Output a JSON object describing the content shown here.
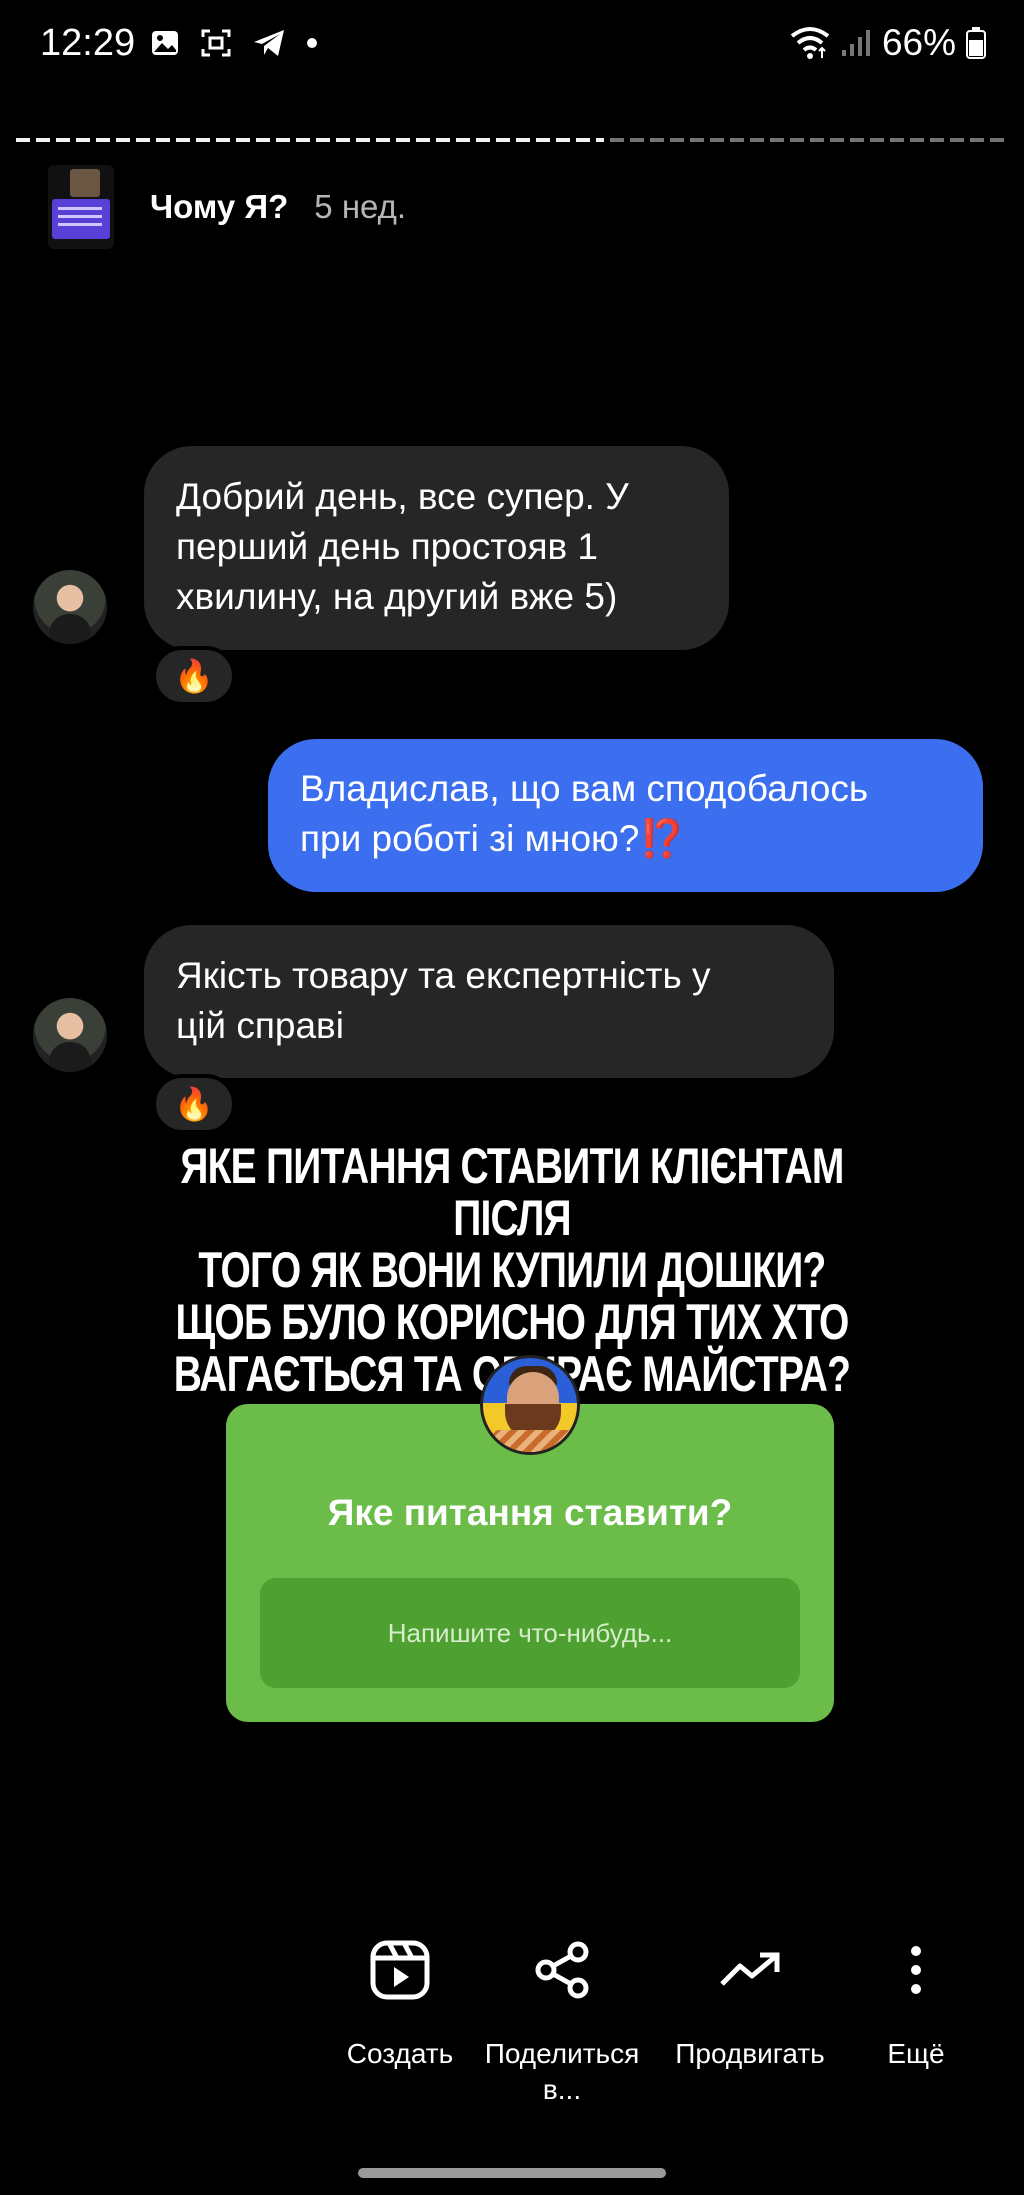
{
  "status_bar": {
    "time": "12:29",
    "battery": "66%",
    "icons": [
      "gallery-icon",
      "screenshot-icon",
      "telegram-icon",
      "dot-icon",
      "wifi-icon",
      "signal-icon",
      "battery-icon"
    ]
  },
  "story": {
    "segments": 2,
    "active_segment": 1,
    "author": "Чому Я?",
    "age": "5 нед."
  },
  "chat": {
    "msg1": "Добрий день, все супер. У\nперший день простояв 1\nхвилину, на другий вже 5)",
    "msg1_reaction": "🔥",
    "msg2": "Владислав, що вам сподобалось\nпри роботі зі мною?",
    "msg2_emoji": "⁉️",
    "msg3": "Якість товару та експертність у\nцій справі",
    "msg3_reaction": "🔥"
  },
  "headline": "ЯКЕ ПИТАННЯ СТАВИТИ КЛІЄНТАМ ПІСЛЯ\nТОГО ЯК ВОНИ КУПИЛИ ДОШКИ?\nЩОБ БУЛО КОРИСНО ДЛЯ ТИХ ХТО\nВАГАЄТЬСЯ ТА ОБИРАЄ МАЙСТРА?",
  "question_sticker": {
    "question": "Яке питання ставити?",
    "placeholder": "Напишите что-нибудь...",
    "color": "#6cbc4a"
  },
  "actions": [
    {
      "label": "Создать",
      "icon": "reels-icon"
    },
    {
      "label": "Поделиться\nв...",
      "icon": "share-icon"
    },
    {
      "label": "Продвигать",
      "icon": "trending-up-icon"
    },
    {
      "label": "Ещё",
      "icon": "more-vertical-icon"
    }
  ]
}
